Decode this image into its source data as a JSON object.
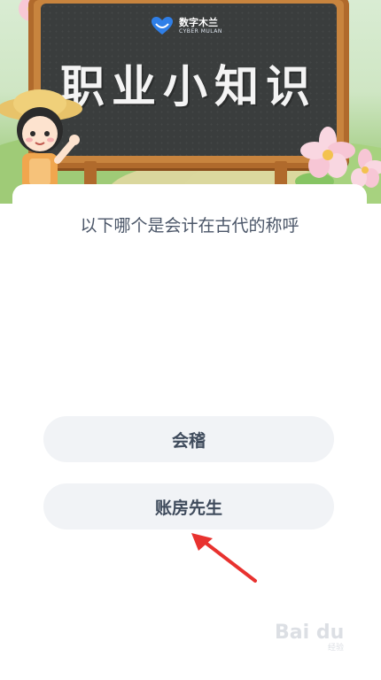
{
  "header": {
    "logo": {
      "name_cn": "数字木兰",
      "name_en": "CYBER MULAN"
    },
    "title": "职业小知识"
  },
  "quiz": {
    "question": "以下哪个是会计在古代的称呼",
    "options": [
      {
        "label": "会稽"
      },
      {
        "label": "账房先生"
      }
    ]
  },
  "watermark": {
    "main": "Bai du",
    "sub": "经验"
  },
  "colors": {
    "board": "#3a3d3d",
    "frame": "#c8843e",
    "option_bg": "#f1f3f6",
    "question_text": "#4b5668",
    "arrow": "#e8322f"
  }
}
